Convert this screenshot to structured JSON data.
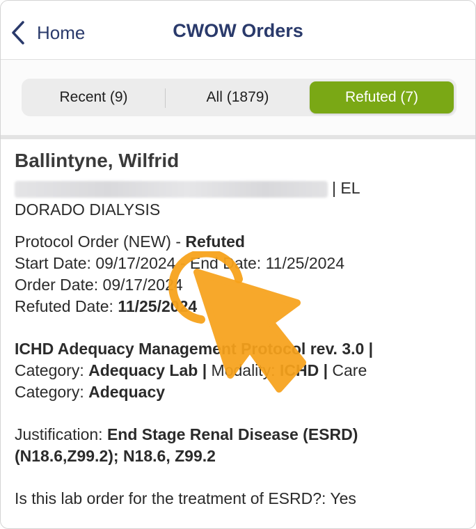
{
  "header": {
    "back_label": "Home",
    "title": "CWOW Orders"
  },
  "segments": [
    {
      "label": "Recent (9)",
      "active": false
    },
    {
      "label": "All (1879)",
      "active": false
    },
    {
      "label": "Refuted (7)",
      "active": true
    }
  ],
  "colors": {
    "accent": "#7aa815",
    "nav_text": "#2a3a6b",
    "pointer": "#f7a21b"
  },
  "order": {
    "patient_name": "Ballintyne, Wilfrid",
    "patient_location_suffix": "| EL",
    "facility": "DORADO DIALYSIS",
    "order_type": "Protocol Order (NEW) -",
    "status": "Refuted",
    "start_date_label": "Start Date:",
    "start_date": "09/17/2024",
    "end_date_label": "- End Date:",
    "end_date": "11/25/2024",
    "order_date_label": "Order Date:",
    "order_date": "09/17/2024",
    "refuted_date_label": "Refuted Date:",
    "refuted_date": "11/25/2024",
    "protocol_name": "ICHD Adequacy Management Protocol rev. 3.0 |",
    "category_label": "Category:",
    "category": "Adequacy Lab |",
    "modality_label": "Modality:",
    "modality": "ICHD |",
    "care_label": "Care",
    "care_category_label": "Category:",
    "care_category": "Adequacy",
    "justification_label": "Justification:",
    "justification_line1": "End Stage Renal Disease (ESRD)",
    "justification_line2": "(N18.6,Z99.2); N18.6, Z99.2",
    "question": "Is this lab order for the treatment of ESRD?: Yes"
  },
  "icons": {
    "back": "chevron-left-icon",
    "pointer": "tap-pointer-icon"
  }
}
